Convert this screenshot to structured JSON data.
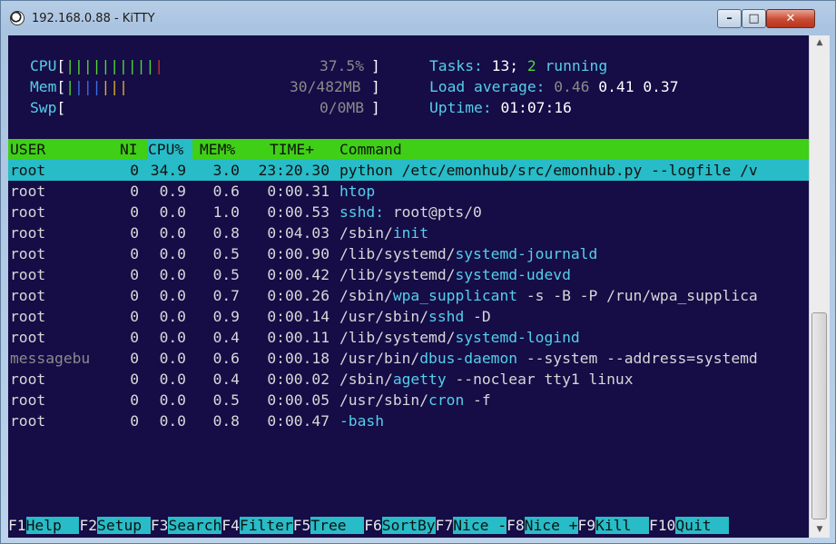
{
  "window": {
    "title": "192.168.0.88 - KiTTY"
  },
  "meters": {
    "cpu": {
      "label": "CPU",
      "bars": "||||||||||",
      "bar_red": "|",
      "value": "37.5%"
    },
    "mem": {
      "label": "Mem",
      "bars_blue": "|||",
      "bars_yellow": "|||",
      "value": "30/482MB"
    },
    "swp": {
      "label": "Swp",
      "value": "0/0MB"
    }
  },
  "stats": {
    "tasks_label": "Tasks:",
    "tasks_count": "13;",
    "running_count": "2",
    "running_label": "running",
    "load_label": "Load average:",
    "load1": "0.46",
    "load5": "0.41",
    "load15": "0.37",
    "uptime_label": "Uptime:",
    "uptime_value": "01:07:16"
  },
  "columns": {
    "user": "USER",
    "ni": "NI",
    "cpu": "CPU%",
    "mem": "MEM%",
    "time": "TIME+",
    "command": "Command"
  },
  "processes": [
    {
      "user": "root",
      "ni": "0",
      "cpu": "34.9",
      "mem": "3.0",
      "time": "23:20.30",
      "cmd_path": "",
      "cmd_name": "python /etc/emonhub/src/emonhub.py --logfile /v",
      "cmd_args": ""
    },
    {
      "user": "root",
      "ni": "0",
      "cpu": "0.9",
      "mem": "0.6",
      "time": "0:00.31",
      "cmd_path": "",
      "cmd_name": "htop",
      "cmd_args": ""
    },
    {
      "user": "root",
      "ni": "0",
      "cpu": "0.0",
      "mem": "1.0",
      "time": "0:00.53",
      "cmd_path": "",
      "cmd_name": "sshd:",
      "cmd_args": " root@pts/0"
    },
    {
      "user": "root",
      "ni": "0",
      "cpu": "0.0",
      "mem": "0.8",
      "time": "0:04.03",
      "cmd_path": "/sbin/",
      "cmd_name": "init",
      "cmd_args": ""
    },
    {
      "user": "root",
      "ni": "0",
      "cpu": "0.0",
      "mem": "0.5",
      "time": "0:00.90",
      "cmd_path": "/lib/systemd/",
      "cmd_name": "systemd-journald",
      "cmd_args": ""
    },
    {
      "user": "root",
      "ni": "0",
      "cpu": "0.0",
      "mem": "0.5",
      "time": "0:00.42",
      "cmd_path": "/lib/systemd/",
      "cmd_name": "systemd-udevd",
      "cmd_args": ""
    },
    {
      "user": "root",
      "ni": "0",
      "cpu": "0.0",
      "mem": "0.7",
      "time": "0:00.26",
      "cmd_path": "/sbin/",
      "cmd_name": "wpa_supplicant",
      "cmd_args": " -s -B -P /run/wpa_supplica"
    },
    {
      "user": "root",
      "ni": "0",
      "cpu": "0.0",
      "mem": "0.9",
      "time": "0:00.14",
      "cmd_path": "/usr/sbin/",
      "cmd_name": "sshd",
      "cmd_args": " -D"
    },
    {
      "user": "root",
      "ni": "0",
      "cpu": "0.0",
      "mem": "0.4",
      "time": "0:00.11",
      "cmd_path": "/lib/systemd/",
      "cmd_name": "systemd-logind",
      "cmd_args": ""
    },
    {
      "user": "messagebu",
      "ni": "0",
      "cpu": "0.0",
      "mem": "0.6",
      "time": "0:00.18",
      "cmd_path": "/usr/bin/",
      "cmd_name": "dbus-daemon",
      "cmd_args": " --system --address=systemd"
    },
    {
      "user": "root",
      "ni": "0",
      "cpu": "0.0",
      "mem": "0.4",
      "time": "0:00.02",
      "cmd_path": "/sbin/",
      "cmd_name": "agetty",
      "cmd_args": " --noclear tty1 linux"
    },
    {
      "user": "root",
      "ni": "0",
      "cpu": "0.0",
      "mem": "0.5",
      "time": "0:00.05",
      "cmd_path": "/usr/sbin/",
      "cmd_name": "cron",
      "cmd_args": " -f"
    },
    {
      "user": "root",
      "ni": "0",
      "cpu": "0.0",
      "mem": "0.8",
      "time": "0:00.47",
      "cmd_path": "",
      "cmd_name": "-bash",
      "cmd_args": ""
    }
  ],
  "fkeys": [
    {
      "key": "F1",
      "label": "Help  "
    },
    {
      "key": "F2",
      "label": "Setup "
    },
    {
      "key": "F3",
      "label": "Search"
    },
    {
      "key": "F4",
      "label": "Filter"
    },
    {
      "key": "F5",
      "label": "Tree  "
    },
    {
      "key": "F6",
      "label": "SortBy"
    },
    {
      "key": "F7",
      "label": "Nice -"
    },
    {
      "key": "F8",
      "label": "Nice +"
    },
    {
      "key": "F9",
      "label": "Kill  "
    },
    {
      "key": "F10",
      "label": "Quit  "
    }
  ]
}
